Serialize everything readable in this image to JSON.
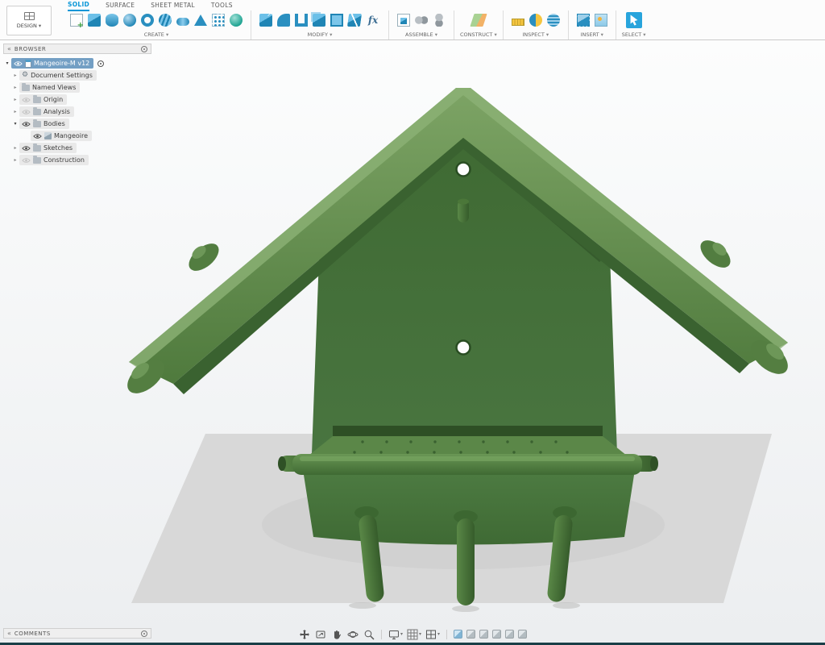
{
  "toolbar": {
    "design_button": {
      "label": "DESIGN"
    },
    "tabs": [
      {
        "label": "SOLID",
        "active": true
      },
      {
        "label": "SURFACE",
        "active": false
      },
      {
        "label": "SHEET METAL",
        "active": false
      },
      {
        "label": "TOOLS",
        "active": false
      }
    ],
    "fx_label": "fx",
    "groups": [
      {
        "label": "CREATE",
        "icons": [
          "create-sketch",
          "box",
          "cylinder",
          "sphere",
          "torus",
          "coil",
          "pipe",
          "prism",
          "pattern",
          "form"
        ]
      },
      {
        "label": "MODIFY",
        "icons": [
          "press-pull",
          "fillet",
          "shell",
          "combine",
          "offset-face",
          "split-body",
          "parameters-fx"
        ]
      },
      {
        "label": "ASSEMBLE",
        "icons": [
          "new-component",
          "joint",
          "as-built-joint"
        ]
      },
      {
        "label": "CONSTRUCT",
        "icons": [
          "construction-plane"
        ]
      },
      {
        "label": "INSPECT",
        "icons": [
          "measure",
          "section-analysis",
          "curvature-analysis"
        ]
      },
      {
        "label": "INSERT",
        "icons": [
          "insert-mesh",
          "decal"
        ]
      },
      {
        "label": "SELECT",
        "icons": [
          "select-cursor"
        ]
      }
    ],
    "accent": "#0696d7"
  },
  "browser": {
    "title": "BROWSER",
    "items": [
      {
        "label": "Mangeoire-M v12",
        "type": "document",
        "selected": true,
        "expanded": true,
        "visible": true
      },
      {
        "label": "Document Settings",
        "type": "settings",
        "expanded": false
      },
      {
        "label": "Named Views",
        "type": "folder",
        "expanded": false
      },
      {
        "label": "Origin",
        "type": "folder",
        "expanded": false,
        "visible": false
      },
      {
        "label": "Analysis",
        "type": "folder",
        "expanded": false,
        "visible": false
      },
      {
        "label": "Bodies",
        "type": "folder",
        "expanded": true,
        "visible": true
      },
      {
        "label": "Mangeoire",
        "type": "body",
        "child": true,
        "visible": true
      },
      {
        "label": "Sketches",
        "type": "folder",
        "expanded": false,
        "visible": true
      },
      {
        "label": "Construction",
        "type": "folder",
        "expanded": false,
        "visible": false
      }
    ]
  },
  "comments": {
    "title": "COMMENTS"
  },
  "viewport": {
    "model": "Mangeoire",
    "colors": {
      "roof_light": "#7da465",
      "roof_dark": "#4f7a3d",
      "roof_underside": "#3a6230",
      "panel_top": "#3f6a33",
      "panel_bottom": "#497540",
      "tray_floor": "#5b8748",
      "face_top": "#4c7a41",
      "face_bottom": "#3f6a34",
      "peg_light": "#5a8847",
      "peg_dark": "#365c2b",
      "ground": "#d8d8d8",
      "background_top": "#fcfdfd",
      "background_bottom": "#eceef0"
    }
  },
  "navbar": {
    "icons": [
      "move",
      "look-at",
      "pan",
      "orbit",
      "zoom",
      "display-settings",
      "grid-snap",
      "viewports",
      "scene-option-1",
      "scene-option-2",
      "scene-option-3",
      "scene-option-4",
      "scene-option-5",
      "scene-option-6"
    ]
  }
}
